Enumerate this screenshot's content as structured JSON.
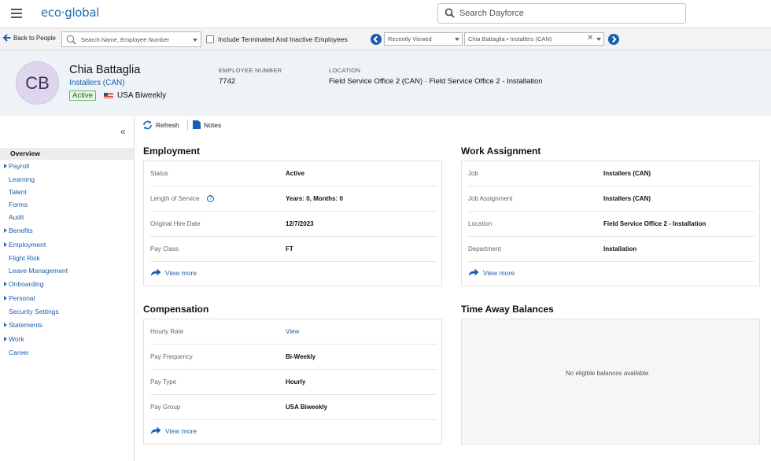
{
  "topbar": {
    "logo": "eco·global",
    "search_placeholder": "Search Dayforce"
  },
  "toolbar": {
    "back_label": "Back to People",
    "employee_search_placeholder": "Search Name, Employee Number",
    "include_terminated_label": "Include Terminated And Inactive Employees",
    "include_terminated_checked": false,
    "recently_viewed_value": "Recently Viewed",
    "selected_employee_value": "Chia Battaglia • Installers (CAN)"
  },
  "employee": {
    "initials": "CB",
    "name": "Chia Battaglia",
    "job": "Installers (CAN)",
    "status": "Active",
    "pay_group": "USA Biweekly",
    "employee_number_label": "EMPLOYEE NUMBER",
    "employee_number": "7742",
    "location_label": "LOCATION",
    "location": "Field Service Office 2 (CAN) · Field Service Office 2 - Installation"
  },
  "sidebar": {
    "items": [
      {
        "label": "Overview",
        "expandable": false,
        "selected": true
      },
      {
        "label": "Payroll",
        "expandable": true
      },
      {
        "label": "Learning",
        "expandable": false
      },
      {
        "label": "Talent",
        "expandable": false
      },
      {
        "label": "Forms",
        "expandable": false
      },
      {
        "label": "Audit",
        "expandable": false
      },
      {
        "label": "Benefits",
        "expandable": true
      },
      {
        "label": "Employment",
        "expandable": true
      },
      {
        "label": "Flight Risk",
        "expandable": false
      },
      {
        "label": "Leave Management",
        "expandable": false
      },
      {
        "label": "Onboarding",
        "expandable": true
      },
      {
        "label": "Personal",
        "expandable": true
      },
      {
        "label": "Security Settings",
        "expandable": false
      },
      {
        "label": "Statements",
        "expandable": true
      },
      {
        "label": "Work",
        "expandable": true
      },
      {
        "label": "Career",
        "expandable": false
      }
    ]
  },
  "actions": {
    "refresh_label": "Refresh",
    "notes_label": "Notes"
  },
  "employment": {
    "title": "Employment",
    "rows": [
      {
        "label": "Status",
        "value": "Active"
      },
      {
        "label": "Length of Service",
        "value": "Years: 0, Months: 0"
      },
      {
        "label": "Original Hire Date",
        "value": "12/7/2023"
      },
      {
        "label": "Pay Class",
        "value": "FT"
      }
    ],
    "view_more": "View more"
  },
  "work_assignment": {
    "title": "Work Assignment",
    "rows": [
      {
        "label": "Job",
        "value": "Installers (CAN)"
      },
      {
        "label": "Job Assignment",
        "value": "Installers (CAN)"
      },
      {
        "label": "Location",
        "value": "Field Service Office 2 - Installation"
      },
      {
        "label": "Department",
        "value": "Installation"
      }
    ],
    "view_more": "View more"
  },
  "compensation": {
    "title": "Compensation",
    "rows": [
      {
        "label": "Hourly Rate",
        "value": "View"
      },
      {
        "label": "Pay Frequency",
        "value": "Bi-Weekly"
      },
      {
        "label": "Pay Type",
        "value": "Hourly"
      },
      {
        "label": "Pay Group",
        "value": "USA Biweekly"
      }
    ],
    "view_more": "View more"
  },
  "time_away": {
    "title": "Time Away Balances",
    "empty_message": "No eligible balances available"
  },
  "colors": {
    "accent": "#1a5fb0",
    "header_band": "#eef3f8",
    "active_badge": "#e9f5e7"
  }
}
